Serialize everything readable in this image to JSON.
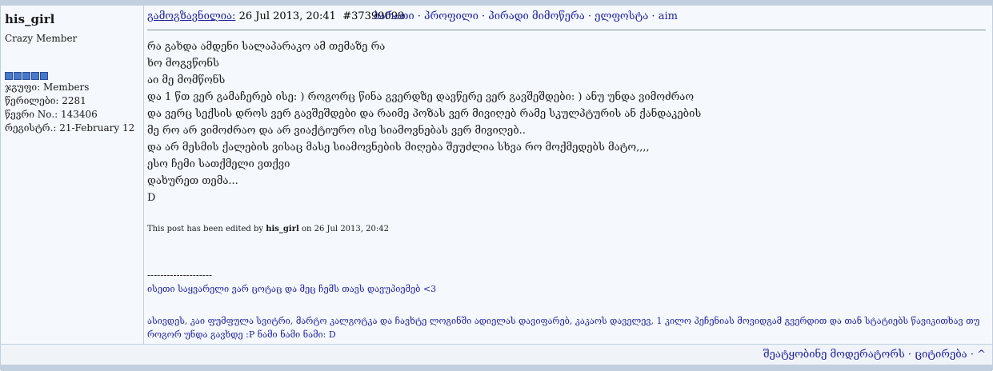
{
  "author": {
    "username": "his_girl",
    "rank": "Crazy Member",
    "pips": 5,
    "stats": [
      "ჯგუფი: Members",
      "წერილები: 2281",
      "წევრი No.: 143406",
      "რეგისტრ.: 21-February 12"
    ]
  },
  "post": {
    "posted_label": "გამოგზავნილია:",
    "date": " 26 Jul 2013, 20:41",
    "post_id": "#37399099",
    "header_links": "ბარათი · პროფილი · პირადი მიმოწერა · ელფოსტა · aim",
    "body_lines": [
      "რა გახდა ამდენი სალაპარაკო ამ თემაზე რა",
      "ხო მოგვწონს",
      "აი მე მომწონს",
      "და 1 წთ ვერ გამაჩერებ ისე: ) როგორც წინა გვერდზე დავწერე ვერ გავშეშდები: ) ანუ უნდა ვიმოძრაო",
      "და ვერც სექსის დროს ვერ გავშეშდები და რაიმე პოზას ვერ მივიღებ რამე სკულპტურის ან ქანდაკების",
      "მე რო არ ვიმოძრაო და არ ვიაქტიურო ისე სიამოვნებას ვერ მივიღებ..",
      "და არ მესმის ქალების ვისაც მასე სიამოვნების მიღება შეუძლია სხვა რო მოქმედებს მატო,,,,",
      "ესო ჩემი სათქმელი ვთქვი",
      "დახურეთ თემა...",
      "D"
    ],
    "edited_prefix": "This post has been edited by ",
    "edited_by": "his_girl",
    "edited_suffix": " on 26 Jul 2013, 20:42",
    "sig_separator": "--------------------",
    "sig_line1": "ისეთი საყვარელი ვარ ცოტაც და მეც ჩემს თავს დავუპიემებ <3",
    "sig_line2": "ასივდეს, კაი ფუმფულა სვიტრი, მარტო კალგოტკა და ჩავხტე ლოგინში ადიელას დავიფარებ, კაკაოს დაველევ, 1 კილო პეჩენიას მოვიდგამ გვერდით და თან სტატიებს წავიკითხავ თუ როგორ უნდა გავხდე :P ნამი ნამი ნამი: D"
  },
  "footer": {
    "links": "შეატყობინე მოდერატორს · ციტირება · ^"
  },
  "colors": {
    "link": "#22229c",
    "border": "#c2cfdf",
    "background": "#f5f9fd"
  }
}
